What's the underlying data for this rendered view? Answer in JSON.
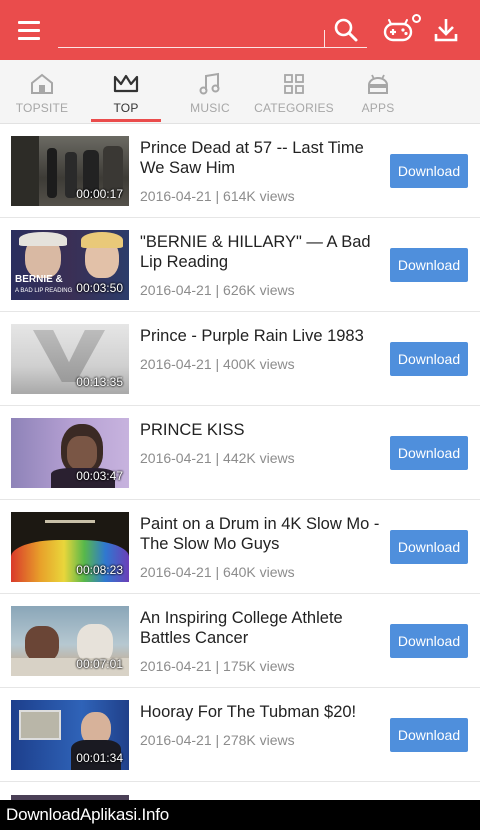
{
  "header": {
    "search_placeholder": "",
    "icons": [
      "menu-icon",
      "search-icon",
      "gamepad-icon",
      "download-icon"
    ],
    "accent_color": "#ea4c4c"
  },
  "tabs": [
    {
      "label": "TOPSITE",
      "icon": "home-icon"
    },
    {
      "label": "TOP",
      "icon": "crown-icon",
      "active": true
    },
    {
      "label": "MUSIC",
      "icon": "music-note-icon"
    },
    {
      "label": "CATEGORIES",
      "icon": "grid-icon"
    },
    {
      "label": "APPS",
      "icon": "android-icon"
    }
  ],
  "videos": [
    {
      "title": "Prince Dead at 57 -- Last Time We Saw Him",
      "meta": "2016-04-21 | 614K views",
      "duration": "00:00:17",
      "button": "Download"
    },
    {
      "title": "\"BERNIE & HILLARY\" — A Bad Lip Reading",
      "meta": "2016-04-21 | 626K views",
      "duration": "00:03:50",
      "button": "Download",
      "thumb_text": [
        "BERNIE &",
        "A BAD LIP READING"
      ]
    },
    {
      "title": "Prince - Purple Rain Live 1983",
      "meta": "2016-04-21 | 400K views",
      "duration": "00:13:35",
      "button": "Download"
    },
    {
      "title": "PRINCE KISS",
      "meta": "2016-04-21 | 442K views",
      "duration": "00:03:47",
      "button": "Download"
    },
    {
      "title": "Paint on a Drum in 4K Slow Mo - The Slow Mo Guys",
      "meta": "2016-04-21 | 640K views",
      "duration": "00:08:23",
      "button": "Download"
    },
    {
      "title": "An Inspiring College Athlete Battles Cancer",
      "meta": "2016-04-21 | 175K views",
      "duration": "00:07:01",
      "button": "Download"
    },
    {
      "title": "Hooray For The Tubman $20!",
      "meta": "2016-04-21 | 278K views",
      "duration": "00:01:34",
      "button": "Download"
    }
  ],
  "watermark": "DownloadAplikasi.Info",
  "button_color": "#4f8fdc"
}
